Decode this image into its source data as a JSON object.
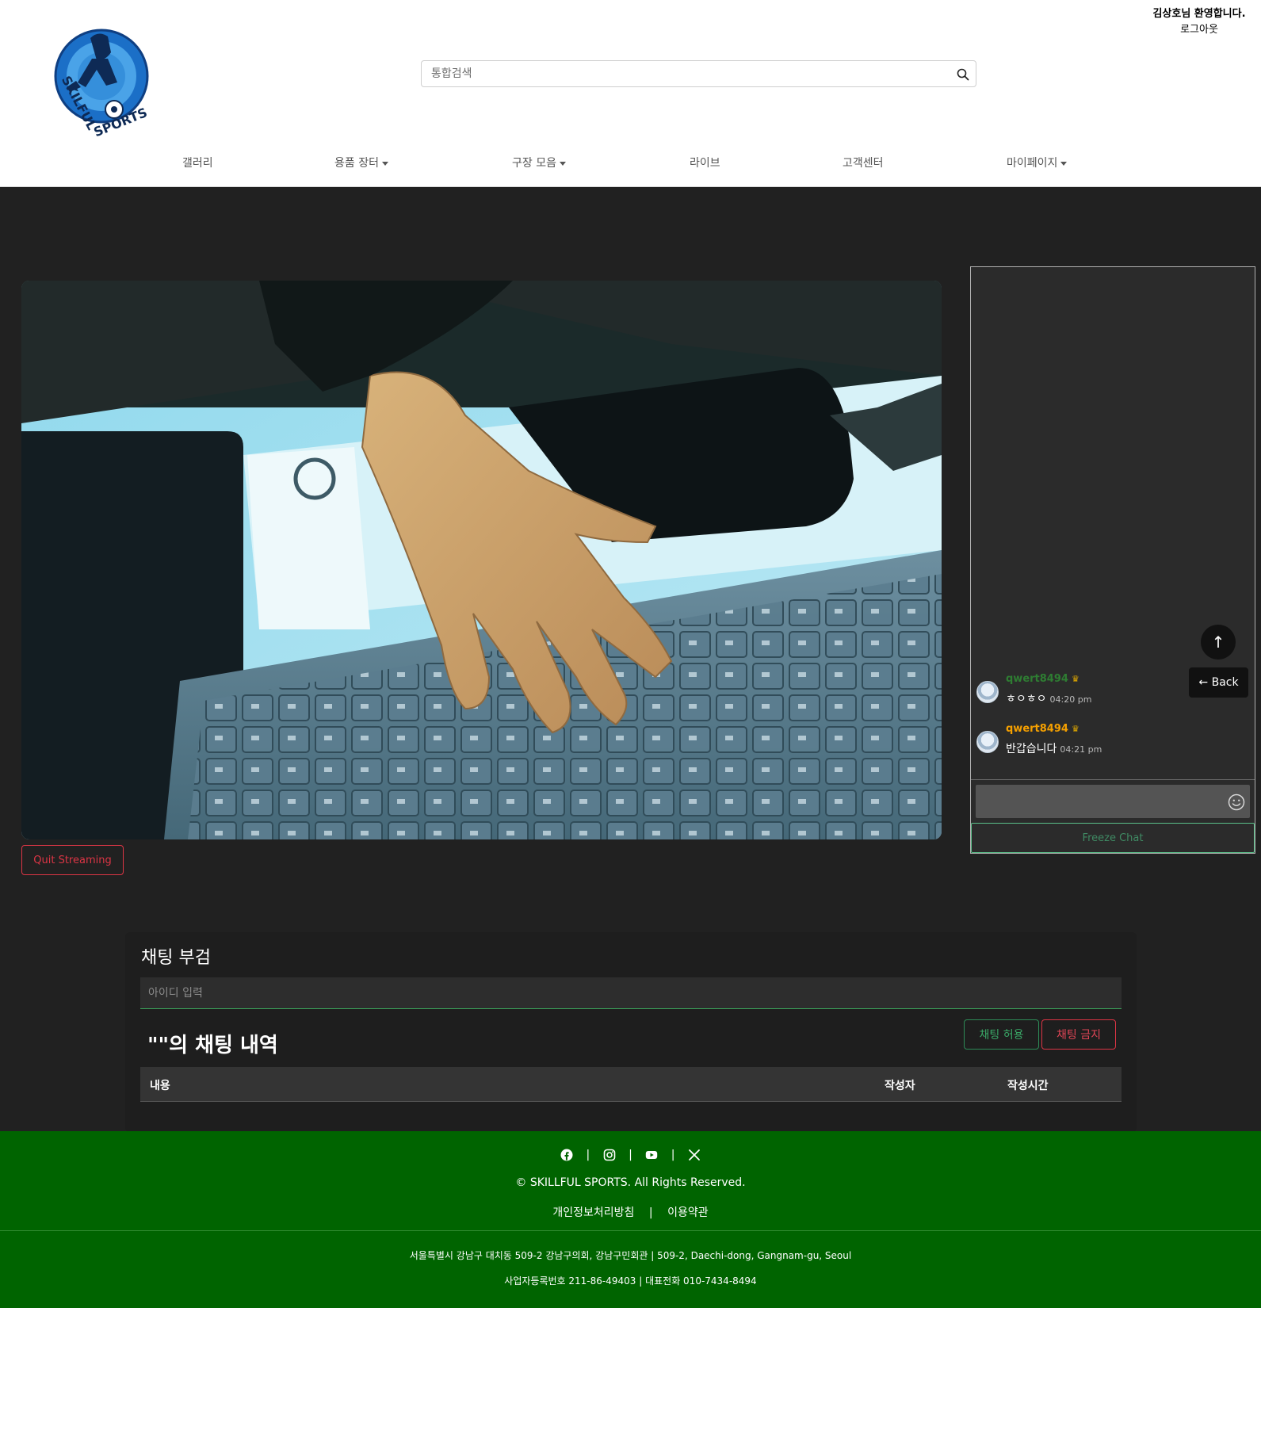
{
  "header": {
    "brand": "SKILFUL SPORTS",
    "search": {
      "placeholder": "통합검색",
      "value": ""
    },
    "welcome": "김상호님 환영합니다.",
    "logout": "로그아웃",
    "nav": [
      {
        "label": "갤러리",
        "dropdown": false
      },
      {
        "label": "용품 장터",
        "dropdown": true
      },
      {
        "label": "구장 모음",
        "dropdown": true
      },
      {
        "label": "라이브",
        "dropdown": false
      },
      {
        "label": "고객센터",
        "dropdown": false
      },
      {
        "label": "마이페이지",
        "dropdown": true
      }
    ]
  },
  "stream": {
    "quit_label": "Quit Streaming"
  },
  "chat": {
    "up_label": "↑",
    "back_label": "← Back",
    "messages": [
      {
        "user": "qwert8494",
        "user_color": "#2e7d32",
        "crown": "♛",
        "text": "ㅎㅇㅎㅇ",
        "time": "04:20 pm"
      },
      {
        "user": "qwert8494",
        "user_color": "#f5a000",
        "crown": "♛",
        "text": "반갑습니다",
        "time": "04:21 pm"
      }
    ],
    "input_placeholder": "",
    "freeze_label": "Freeze Chat"
  },
  "ban_panel": {
    "title": "채팅 부검",
    "id_placeholder": "아이디 입력",
    "history_title": "\"\"의 채팅 내역",
    "allow_label": "채팅 허용",
    "ban_label": "채팅 금지",
    "columns": [
      "내용",
      "작성자",
      "작성시간"
    ]
  },
  "footer": {
    "social_icons": [
      "facebook-icon",
      "instagram-icon",
      "youtube-icon",
      "x-icon"
    ],
    "separator": "|",
    "copyright": "© SKILLFUL SPORTS. All Rights Reserved.",
    "privacy": "개인정보처리방침",
    "terms": "이용약관",
    "link_separator": "|",
    "address": "서울특별시 강남구 대치동 509-2 강남구의회, 강남구민회관 | 509-2, Daechi-dong, Gangnam-gu, Seoul",
    "bizinfo": "사업자등록번호 211-86-49403 | 대표전화 010-7434-8494"
  },
  "colors": {
    "footer_bg": "#006400",
    "dark_bg": "#212121",
    "danger": "#dc3545",
    "success": "#2e8b57"
  }
}
